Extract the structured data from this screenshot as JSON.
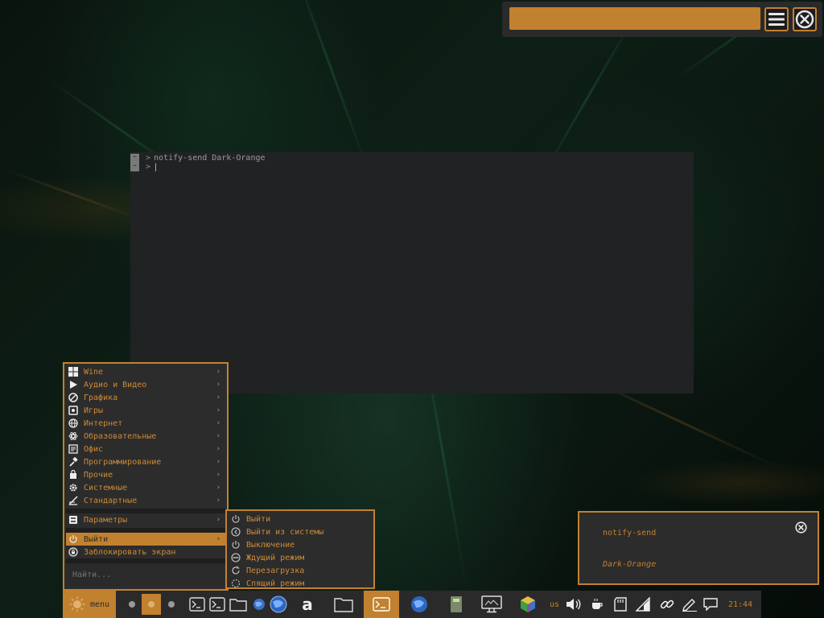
{
  "search_popup": {
    "placeholder": "",
    "value": ""
  },
  "terminal": {
    "lines": [
      {
        "gutter": "~",
        "prompt": ">",
        "text": "notify-send Dark-Orange"
      },
      {
        "gutter": "~",
        "prompt": ">",
        "text": ""
      }
    ]
  },
  "main_menu": {
    "items": [
      {
        "label": "Wine",
        "icon": "windows-icon"
      },
      {
        "label": "Аудио и Видео",
        "icon": "play-icon"
      },
      {
        "label": "Графика",
        "icon": "graphics-icon"
      },
      {
        "label": "Игры",
        "icon": "games-icon"
      },
      {
        "label": "Интернет",
        "icon": "globe-icon"
      },
      {
        "label": "Образовательные",
        "icon": "atom-icon"
      },
      {
        "label": "Офис",
        "icon": "office-icon"
      },
      {
        "label": "Программирование",
        "icon": "hammer-icon"
      },
      {
        "label": "Прочие",
        "icon": "bag-icon"
      },
      {
        "label": "Системные",
        "icon": "gear-icon"
      },
      {
        "label": "Стандартные",
        "icon": "accessories-icon"
      }
    ],
    "settings": {
      "label": "Параметры",
      "icon": "settings-icon"
    },
    "logout": {
      "label": "Выйти",
      "icon": "power-icon"
    },
    "lock": {
      "label": "Заблокировать экран",
      "icon": "lock-icon"
    },
    "search_placeholder": "Найти..."
  },
  "sub_menu": {
    "items": [
      {
        "label": "Выйти",
        "icon": "power-icon"
      },
      {
        "label": "Выйти из системы",
        "icon": "logout-icon"
      },
      {
        "label": "Выключение",
        "icon": "shutdown-icon"
      },
      {
        "label": "Ждущий режим",
        "icon": "suspend-icon"
      },
      {
        "label": "Перезагрузка",
        "icon": "reboot-icon"
      },
      {
        "label": "Спящий режим",
        "icon": "hibernate-icon"
      }
    ]
  },
  "notification": {
    "title": "notify-send",
    "body": "Dark-Orange"
  },
  "taskbar": {
    "menu_label": "menu",
    "keyboard_layout": "us",
    "clock": "21:44"
  },
  "colors": {
    "accent": "#c2812f",
    "panel": "#2c2c2c",
    "terminal_bg": "#212224"
  }
}
